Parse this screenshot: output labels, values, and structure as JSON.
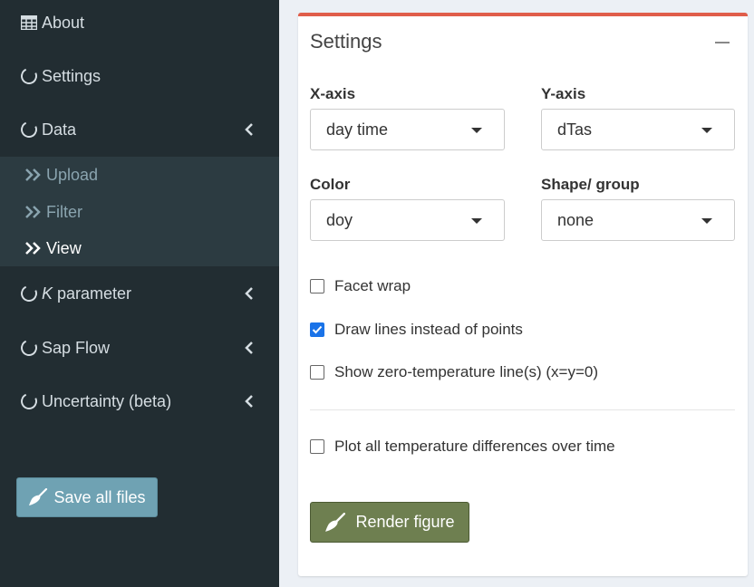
{
  "sidebar": {
    "items": [
      {
        "label": "About",
        "icon": "table-icon"
      },
      {
        "label": "Settings",
        "icon": "circle-notch-icon"
      },
      {
        "label": "Data",
        "icon": "circle-notch-icon"
      },
      {
        "label_italic": "K",
        "label": " parameter",
        "icon": "circle-notch-icon"
      },
      {
        "label": "Sap Flow",
        "icon": "circle-notch-icon"
      },
      {
        "label": "Uncertainty (beta)",
        "icon": "circle-notch-icon"
      }
    ],
    "data_submenu": [
      {
        "label": "Upload"
      },
      {
        "label": "Filter"
      },
      {
        "label": "View",
        "active": true
      }
    ],
    "save_button": "Save all files"
  },
  "settings": {
    "title": "Settings",
    "xaxis": {
      "label": "X-axis",
      "value": "day time"
    },
    "yaxis": {
      "label": "Y-axis",
      "value": "dTas"
    },
    "color": {
      "label": "Color",
      "value": "doy"
    },
    "shape": {
      "label": "Shape/ group",
      "value": "none"
    },
    "checkboxes": [
      {
        "label": "Facet wrap",
        "checked": false
      },
      {
        "label": "Draw lines instead of points",
        "checked": true
      },
      {
        "label": "Show zero-temperature line(s) (x=y=0)",
        "checked": false
      },
      {
        "label": "Plot all temperature differences over time",
        "checked": false
      }
    ],
    "render_button": "Render figure"
  },
  "colors": {
    "sidebar_bg": "#222d32",
    "submenu_bg": "#2c3b41",
    "box_accent": "#e05d4a",
    "render_button": "#6e7f50",
    "save_button": "#6fa2b3",
    "checkbox_checked": "#1a73e8"
  }
}
